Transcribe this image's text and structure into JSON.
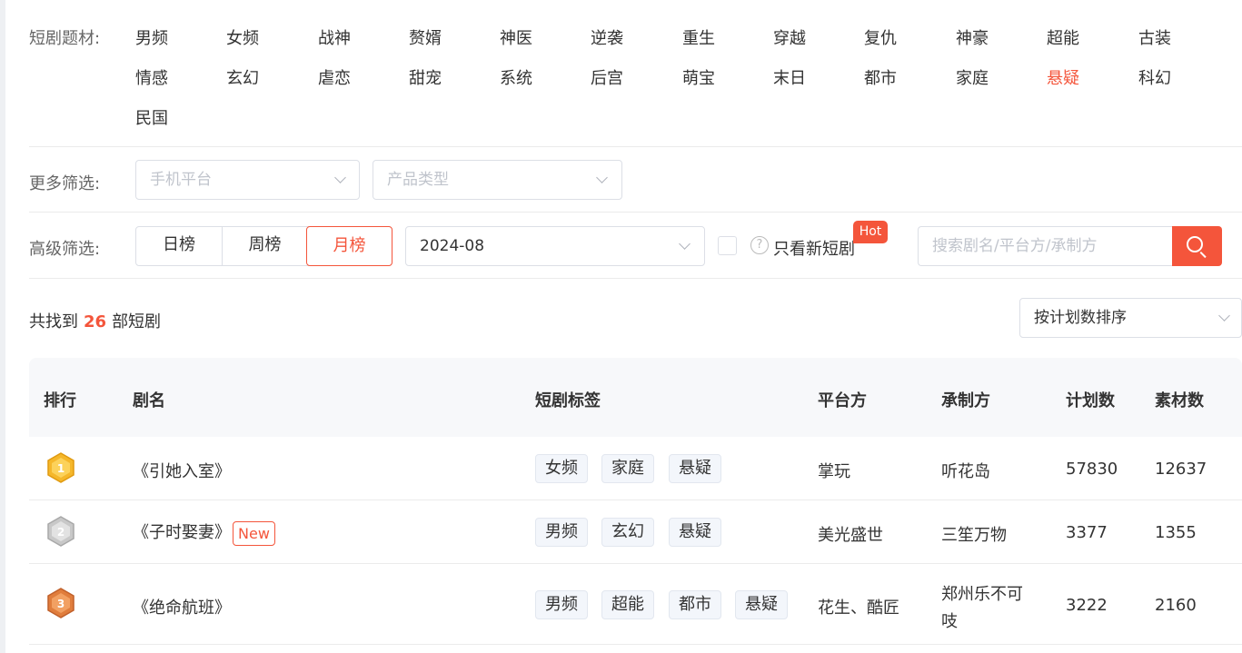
{
  "filters": {
    "genre_label": "短剧题材:",
    "genres": [
      "男频",
      "女频",
      "战神",
      "赘婿",
      "神医",
      "逆袭",
      "重生",
      "穿越",
      "复仇",
      "神豪",
      "超能",
      "古装",
      "情感",
      "玄幻",
      "虐恋",
      "甜宠",
      "系统",
      "后宫",
      "萌宝",
      "末日",
      "都市",
      "家庭",
      "悬疑",
      "科幻",
      "民国"
    ],
    "active_genre": "悬疑",
    "more_label": "更多筛选:",
    "platform_placeholder": "手机平台",
    "product_placeholder": "产品类型",
    "advanced_label": "高级筛选:",
    "rank_tabs": [
      "日榜",
      "周榜",
      "月榜"
    ],
    "active_tab": "月榜",
    "month_value": "2024-08",
    "only_new_label": "只看新短剧",
    "hot_badge": "Hot",
    "search_placeholder": "搜索剧名/平台方/承制方"
  },
  "results": {
    "prefix": "共找到",
    "count": "26",
    "suffix": "部短剧",
    "sort_value": "按计划数排序"
  },
  "table": {
    "headers": {
      "rank": "排行",
      "name": "剧名",
      "tags": "短剧标签",
      "platform": "平台方",
      "producer": "承制方",
      "plans": "计划数",
      "materials": "素材数"
    },
    "rows": [
      {
        "rank": "1",
        "medal": "gold",
        "name": "《引她入室》",
        "is_new": false,
        "tags": [
          "女频",
          "家庭",
          "悬疑"
        ],
        "platform": "掌玩",
        "producer": "听花岛",
        "plans": "57830",
        "materials": "12637"
      },
      {
        "rank": "2",
        "medal": "silver",
        "name": "《子时娶妻》",
        "is_new": true,
        "new_label": "New",
        "tags": [
          "男频",
          "玄幻",
          "悬疑"
        ],
        "platform": "美光盛世",
        "producer": "三笙万物",
        "plans": "3377",
        "materials": "1355"
      },
      {
        "rank": "3",
        "medal": "bronze",
        "name": "《绝命航班》",
        "is_new": false,
        "tags": [
          "男频",
          "超能",
          "都市",
          "悬疑"
        ],
        "platform": "花生、酷匠",
        "producer": "郑州乐不可",
        "producer2": "吱",
        "plans": "3222",
        "materials": "2160"
      }
    ]
  },
  "colors": {
    "accent": "#f4553b",
    "gold": "#f5b72a",
    "silver": "#c8c8c8",
    "bronze": "#e07d3c"
  }
}
